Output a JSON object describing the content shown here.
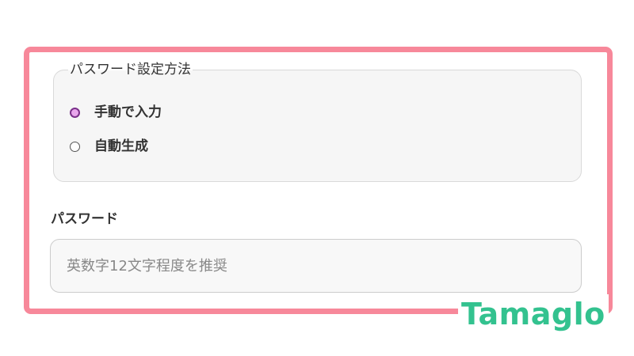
{
  "password_method": {
    "legend": "パスワード設定方法",
    "options": [
      {
        "label": "手動で入力",
        "checked": true
      },
      {
        "label": "自動生成",
        "checked": false
      }
    ]
  },
  "password": {
    "label": "パスワード",
    "placeholder": "英数字12文字程度を推奨",
    "value": ""
  },
  "watermark": {
    "text": "Tamaglo"
  },
  "colors": {
    "highlight_border": "#f7889a",
    "radio_checked_fill": "#e9a6ec",
    "radio_checked_border": "#7a2f8a",
    "panel_background": "#f6f6f6",
    "watermark_text": "#33c28f"
  }
}
